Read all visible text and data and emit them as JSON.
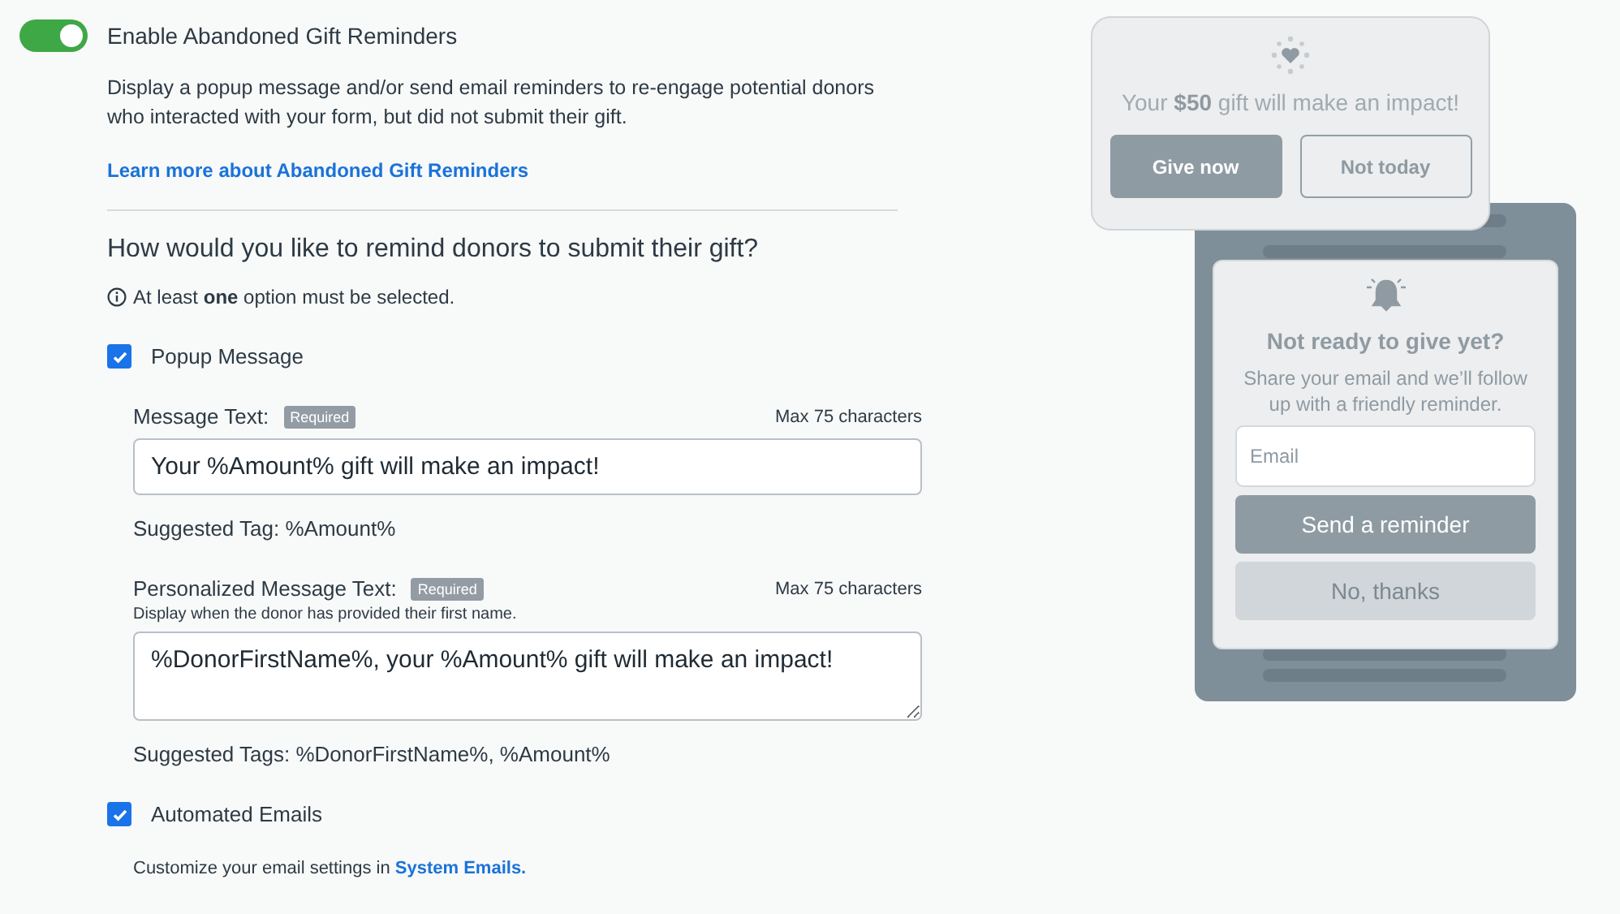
{
  "toggle": {
    "label": "Enable Abandoned Gift Reminders",
    "on": true
  },
  "description": "Display a popup message and/or send email reminders to re-engage potential donors who interacted with your form, but did not submit their gift.",
  "learn_more_link": "Learn more about Abandoned Gift Reminders",
  "question": "How would you like to remind donors to submit their gift?",
  "hint": "At least **one** option must be selected.",
  "options": [
    {
      "label": "Popup Message",
      "checked": true,
      "fields": [
        {
          "kind": "input",
          "label": "Message Text:",
          "badge": "Required",
          "max": "Max 75 characters",
          "value": "Your %Amount% gift will make an impact!",
          "suggested": "Suggested Tag: %Amount%"
        },
        {
          "kind": "textarea",
          "label": "Personalized Message Text:",
          "badge": "Required",
          "max": "Max 75 characters",
          "help": "Display when the donor has provided their first name.",
          "value": "%DonorFirstName%, your %Amount% gift will make an impact!",
          "suggested": "Suggested Tags: %DonorFirstName%, %Amount%"
        }
      ]
    },
    {
      "label": "Automated Emails",
      "checked": true,
      "note": "Customize your email settings in",
      "note_link": "System Emails."
    }
  ],
  "preview": {
    "popup": {
      "message": "Your **$50** gift will make an impact!",
      "primary": "Give now",
      "secondary": "Not today"
    },
    "reminder": {
      "title": "Not ready to give yet?",
      "text": "Share your email and we’ll follow up with a friendly reminder.",
      "email_placeholder": "Email",
      "primary": "Send a reminder",
      "secondary": "No, thanks"
    }
  }
}
